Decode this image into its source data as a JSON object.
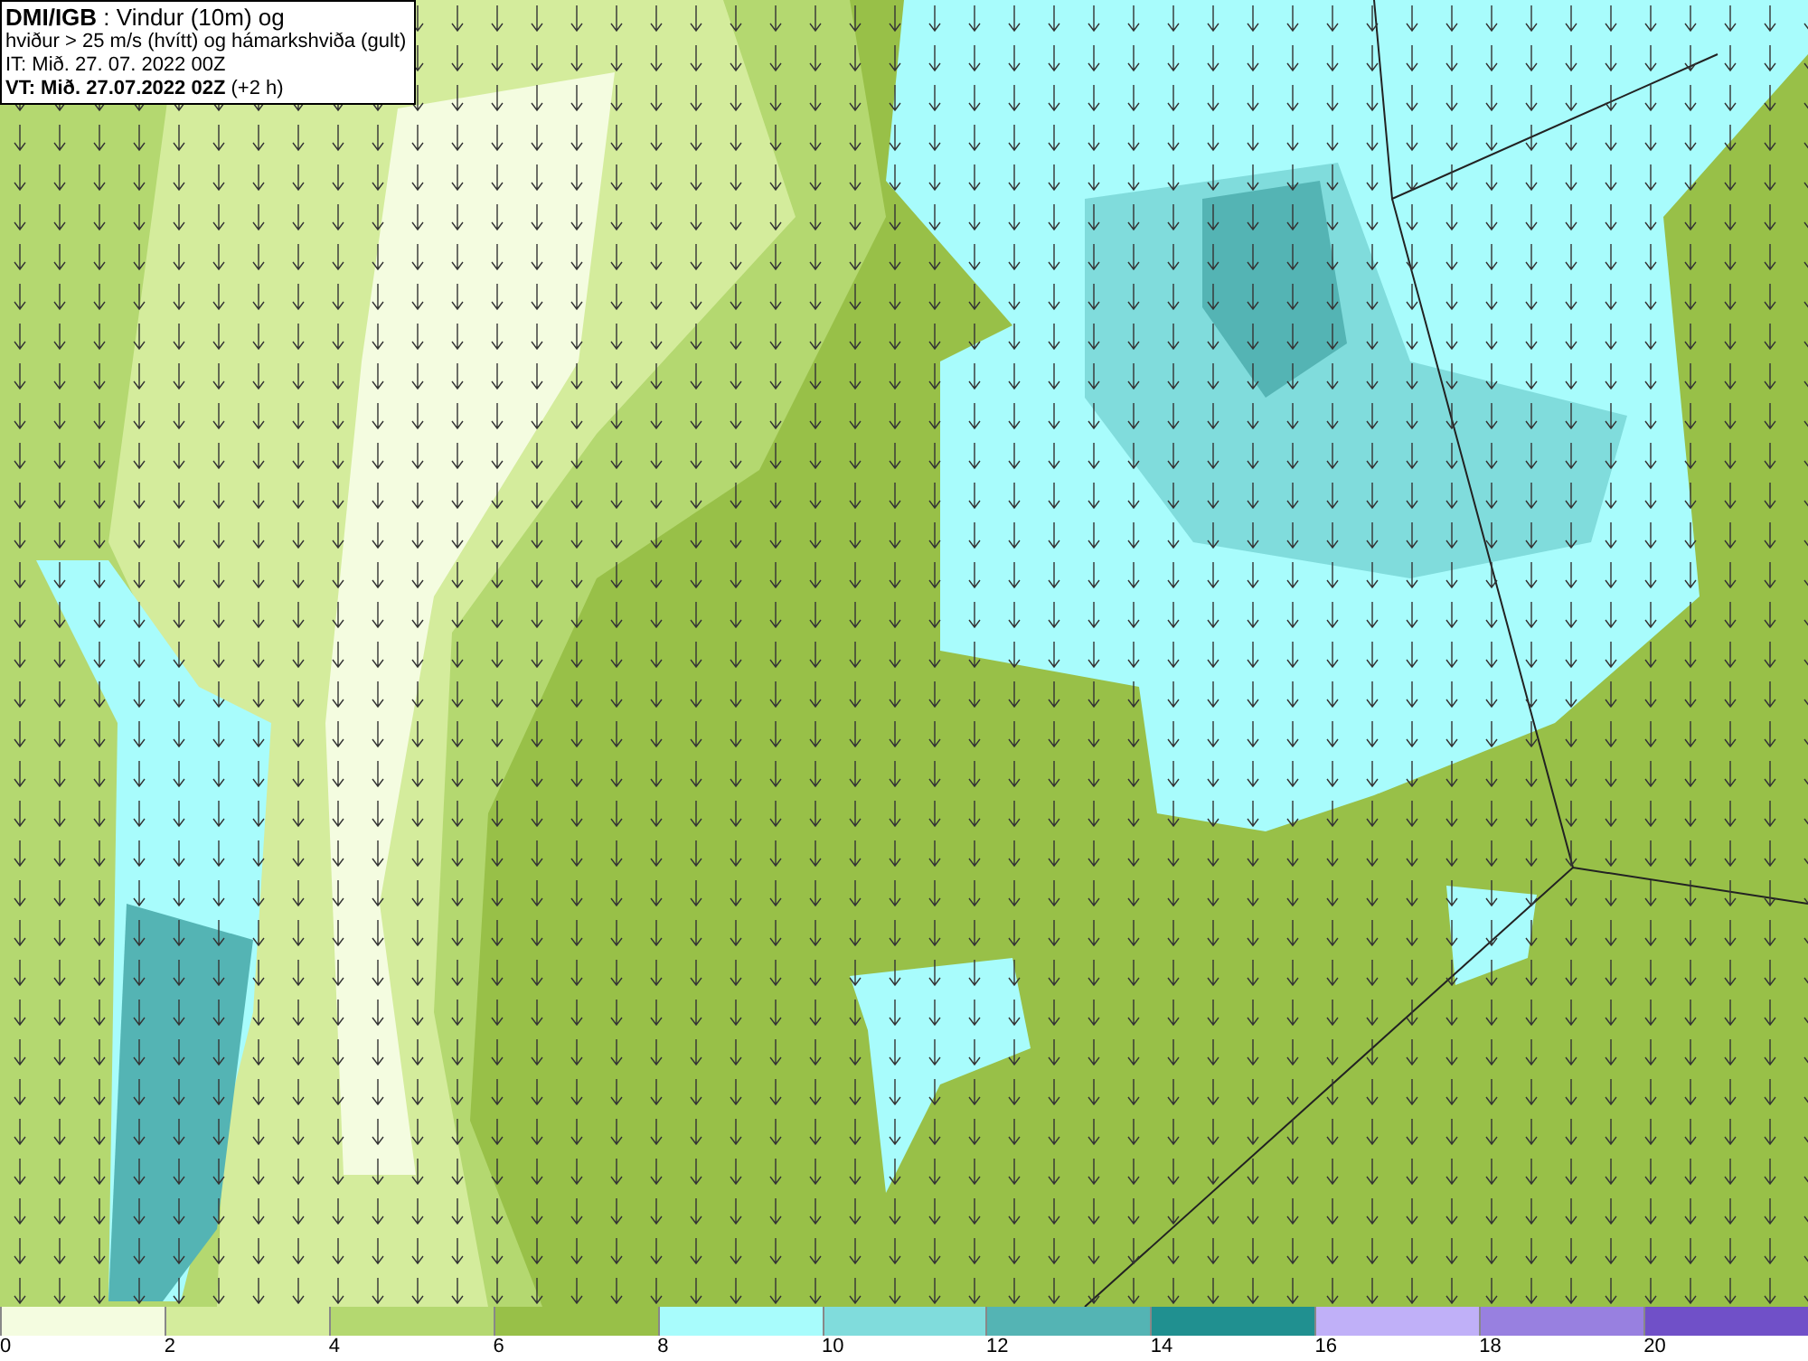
{
  "title_box": {
    "lines": [
      "**DMI/IGB** : Vindur (10m) og",
      "hviður > 25 m/s (hvítt) og hámarkshviða (gult)",
      "IT: Mið. 27. 07. 2022 00Z",
      "**VT: Mið. 27.07.2022 02Z** (+2 h)"
    ]
  },
  "legend": {
    "bins": [
      {
        "label": "0",
        "color": "#f4fce0"
      },
      {
        "label": "2",
        "color": "#d4ec9c"
      },
      {
        "label": "4",
        "color": "#b4d870"
      },
      {
        "label": "6",
        "color": "#98c048"
      },
      {
        "label": "8",
        "color": "#a8fcfc"
      },
      {
        "label": "10",
        "color": "#80dcdc"
      },
      {
        "label": "12",
        "color": "#54b4b4"
      },
      {
        "label": "14",
        "color": "#209090"
      },
      {
        "label": "16",
        "color": "#c0b0f8"
      },
      {
        "label": "18",
        "color": "#9880e0"
      },
      {
        "label": "20",
        "color": "#7050c8"
      }
    ]
  }
}
